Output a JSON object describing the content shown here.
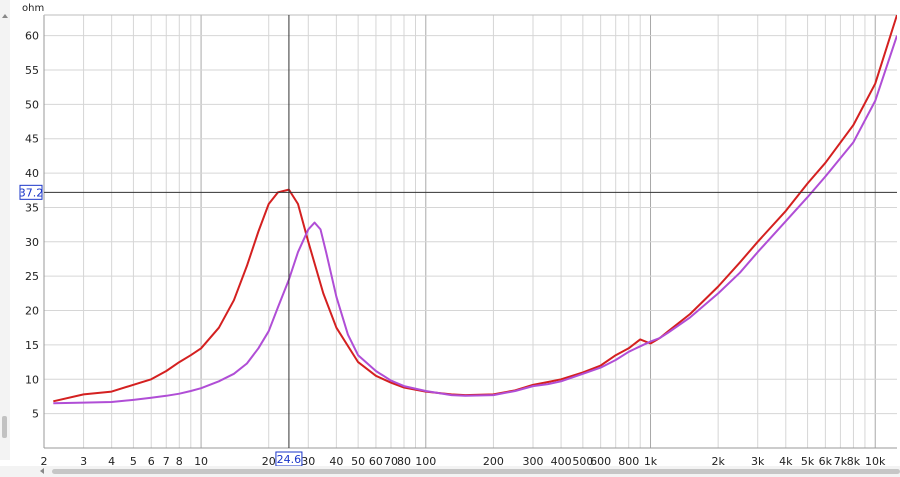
{
  "chart_data": {
    "type": "line",
    "title": "",
    "xlabel": "",
    "ylabel": "ohm",
    "xscale": "log",
    "xlim": [
      2,
      12500
    ],
    "ylim": [
      0,
      63
    ],
    "grid": true,
    "x_tick_labels": [
      {
        "x": 2,
        "label": "2"
      },
      {
        "x": 3,
        "label": "3"
      },
      {
        "x": 4,
        "label": "4"
      },
      {
        "x": 5,
        "label": "5"
      },
      {
        "x": 6,
        "label": "6"
      },
      {
        "x": 7,
        "label": "7"
      },
      {
        "x": 8,
        "label": "8"
      },
      {
        "x": 10,
        "label": "10"
      },
      {
        "x": 20,
        "label": "20"
      },
      {
        "x": 30,
        "label": "30"
      },
      {
        "x": 40,
        "label": "40"
      },
      {
        "x": 50,
        "label": "50"
      },
      {
        "x": 60,
        "label": "60"
      },
      {
        "x": 70,
        "label": "70"
      },
      {
        "x": 80,
        "label": "80"
      },
      {
        "x": 100,
        "label": "100"
      },
      {
        "x": 200,
        "label": "200"
      },
      {
        "x": 300,
        "label": "300"
      },
      {
        "x": 400,
        "label": "400"
      },
      {
        "x": 500,
        "label": "500"
      },
      {
        "x": 600,
        "label": "600"
      },
      {
        "x": 800,
        "label": "800"
      },
      {
        "x": 1000,
        "label": "1k"
      },
      {
        "x": 2000,
        "label": "2k"
      },
      {
        "x": 3000,
        "label": "3k"
      },
      {
        "x": 4000,
        "label": "4k"
      },
      {
        "x": 5000,
        "label": "5k"
      },
      {
        "x": 6000,
        "label": "6k"
      },
      {
        "x": 7000,
        "label": "7k"
      },
      {
        "x": 8000,
        "label": "8k"
      },
      {
        "x": 10000,
        "label": "10k"
      }
    ],
    "y_ticks": [
      5,
      10,
      15,
      20,
      25,
      30,
      35,
      40,
      45,
      50,
      55,
      60
    ],
    "cursor": {
      "x": 24.6,
      "y": 37.2,
      "x_label": "24.6",
      "y_label": "37.2"
    },
    "series": [
      {
        "color": "#d42020",
        "x": [
          2.2,
          3,
          4,
          5,
          6,
          7,
          8,
          9,
          10,
          12,
          14,
          16,
          18,
          20,
          22,
          24.6,
          27,
          30,
          35,
          40,
          50,
          60,
          70,
          80,
          100,
          130,
          150,
          200,
          250,
          300,
          350,
          400,
          500,
          600,
          700,
          800,
          900,
          1000,
          1100,
          1200,
          1500,
          2000,
          2500,
          3000,
          4000,
          5000,
          6000,
          8000,
          10000,
          12500
        ],
        "y": [
          6.8,
          7.8,
          8.2,
          9.2,
          10.0,
          11.2,
          12.5,
          13.5,
          14.5,
          17.5,
          21.5,
          26.5,
          31.5,
          35.5,
          37.2,
          37.6,
          35.5,
          30.0,
          22.5,
          17.5,
          12.5,
          10.5,
          9.5,
          8.8,
          8.2,
          7.8,
          7.7,
          7.8,
          8.4,
          9.2,
          9.6,
          10.0,
          11.0,
          12.0,
          13.5,
          14.5,
          15.8,
          15.2,
          16.0,
          17.0,
          19.5,
          23.5,
          27.0,
          30.0,
          34.5,
          38.5,
          41.5,
          47.0,
          53.0,
          63.0
        ]
      },
      {
        "color": "#b04ed6",
        "x": [
          2.2,
          3,
          4,
          5,
          6,
          7,
          8,
          9,
          10,
          12,
          14,
          16,
          18,
          20,
          22,
          24.6,
          27,
          30,
          32,
          34,
          36,
          40,
          45,
          50,
          60,
          70,
          80,
          100,
          130,
          150,
          200,
          250,
          300,
          350,
          400,
          500,
          600,
          700,
          800,
          900,
          1000,
          1100,
          1200,
          1500,
          2000,
          2500,
          3000,
          4000,
          5000,
          6000,
          8000,
          10000,
          12500
        ],
        "y": [
          6.5,
          6.6,
          6.7,
          7.0,
          7.3,
          7.6,
          7.9,
          8.3,
          8.7,
          9.7,
          10.8,
          12.3,
          14.5,
          17.0,
          20.5,
          24.5,
          28.5,
          31.8,
          32.8,
          31.8,
          28.5,
          22.0,
          16.5,
          13.5,
          11.2,
          9.8,
          9.0,
          8.3,
          7.7,
          7.6,
          7.7,
          8.3,
          9.0,
          9.3,
          9.7,
          10.8,
          11.7,
          12.8,
          14.0,
          14.8,
          15.5,
          16.0,
          16.8,
          19.0,
          22.5,
          25.5,
          28.5,
          33.0,
          36.5,
          39.5,
          44.5,
          50.5,
          60.0
        ]
      }
    ]
  }
}
